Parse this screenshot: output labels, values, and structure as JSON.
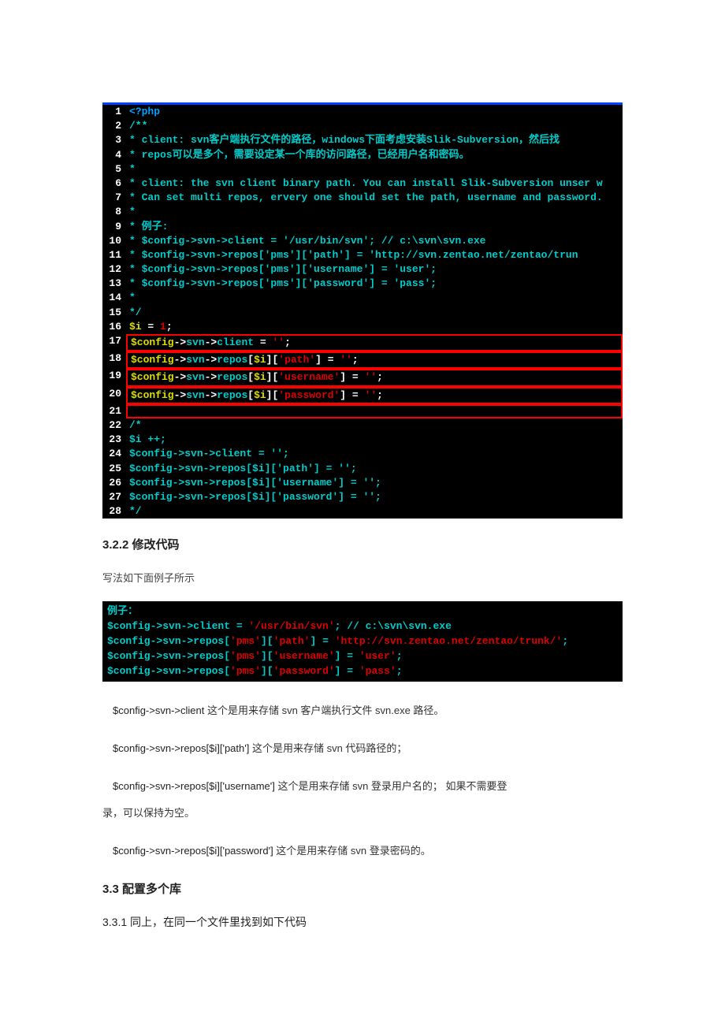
{
  "code1": {
    "lines": [
      {
        "n": 1,
        "segs": [
          {
            "t": "<?php",
            "c": "c-blue"
          }
        ]
      },
      {
        "n": 2,
        "segs": [
          {
            "t": "/**",
            "c": "c-cyan"
          }
        ]
      },
      {
        "n": 3,
        "segs": [
          {
            "t": " * client: svn客户端执行文件的路径，windows下面考虑安装Slik-Subversion，然后找",
            "c": "c-cyan"
          }
        ]
      },
      {
        "n": 4,
        "segs": [
          {
            "t": " * repos可以是多个，需要设定某一个库的访问路径，已经用户名和密码。",
            "c": "c-cyan"
          }
        ]
      },
      {
        "n": 5,
        "segs": [
          {
            "t": " *",
            "c": "c-cyan"
          }
        ]
      },
      {
        "n": 6,
        "segs": [
          {
            "t": " * client: the svn client binary path. You can install Slik-Subversion unser w",
            "c": "c-cyan"
          }
        ]
      },
      {
        "n": 7,
        "segs": [
          {
            "t": " * Can set multi repos, ervery one should set the path, username and password.",
            "c": "c-cyan"
          }
        ]
      },
      {
        "n": 8,
        "segs": [
          {
            "t": " *",
            "c": "c-cyan"
          }
        ]
      },
      {
        "n": 9,
        "segs": [
          {
            "t": " * 例子:",
            "c": "c-cyan"
          }
        ]
      },
      {
        "n": 10,
        "segs": [
          {
            "t": " * $config->svn->client = '/usr/bin/svn'; // c:\\svn\\svn.exe",
            "c": "c-cyan"
          }
        ]
      },
      {
        "n": 11,
        "segs": [
          {
            "t": " * $config->svn->repos['pms']['path']     = 'http://svn.zentao.net/zentao/trun",
            "c": "c-cyan"
          }
        ]
      },
      {
        "n": 12,
        "segs": [
          {
            "t": " * $config->svn->repos['pms']['username'] = 'user';",
            "c": "c-cyan"
          }
        ]
      },
      {
        "n": 13,
        "segs": [
          {
            "t": " * $config->svn->repos['pms']['password'] = 'pass';",
            "c": "c-cyan"
          }
        ]
      },
      {
        "n": 14,
        "segs": [
          {
            "t": " *",
            "c": "c-cyan"
          }
        ]
      },
      {
        "n": 15,
        "segs": [
          {
            "t": " */",
            "c": "c-cyan"
          }
        ]
      },
      {
        "n": 16,
        "segs": [
          {
            "t": "$i",
            "c": "c-yellow"
          },
          {
            "t": " = ",
            "c": "c-white"
          },
          {
            "t": "1",
            "c": "c-red"
          },
          {
            "t": ";",
            "c": "c-white"
          }
        ]
      },
      {
        "n": 17,
        "box": true,
        "segs": [
          {
            "t": "$config",
            "c": "c-yellow"
          },
          {
            "t": "->",
            "c": "c-white"
          },
          {
            "t": "svn",
            "c": "c-cyan"
          },
          {
            "t": "->",
            "c": "c-white"
          },
          {
            "t": "client",
            "c": "c-cyan"
          },
          {
            "t": " = ",
            "c": "c-white"
          },
          {
            "t": "''",
            "c": "c-red"
          },
          {
            "t": ";",
            "c": "c-white"
          }
        ]
      },
      {
        "n": 18,
        "box": true,
        "segs": [
          {
            "t": "$config",
            "c": "c-yellow"
          },
          {
            "t": "->",
            "c": "c-white"
          },
          {
            "t": "svn",
            "c": "c-cyan"
          },
          {
            "t": "->",
            "c": "c-white"
          },
          {
            "t": "repos",
            "c": "c-cyan"
          },
          {
            "t": "[",
            "c": "c-white"
          },
          {
            "t": "$i",
            "c": "c-yellow"
          },
          {
            "t": "][",
            "c": "c-white"
          },
          {
            "t": "'path'",
            "c": "c-red"
          },
          {
            "t": "]     = ",
            "c": "c-white"
          },
          {
            "t": "''",
            "c": "c-red"
          },
          {
            "t": ";",
            "c": "c-white"
          }
        ]
      },
      {
        "n": 19,
        "box": true,
        "segs": [
          {
            "t": "$config",
            "c": "c-yellow"
          },
          {
            "t": "->",
            "c": "c-white"
          },
          {
            "t": "svn",
            "c": "c-cyan"
          },
          {
            "t": "->",
            "c": "c-white"
          },
          {
            "t": "repos",
            "c": "c-cyan"
          },
          {
            "t": "[",
            "c": "c-white"
          },
          {
            "t": "$i",
            "c": "c-yellow"
          },
          {
            "t": "][",
            "c": "c-white"
          },
          {
            "t": "'username'",
            "c": "c-red"
          },
          {
            "t": "] = ",
            "c": "c-white"
          },
          {
            "t": "''",
            "c": "c-red"
          },
          {
            "t": ";",
            "c": "c-white"
          }
        ]
      },
      {
        "n": 20,
        "box": true,
        "segs": [
          {
            "t": "$config",
            "c": "c-yellow"
          },
          {
            "t": "->",
            "c": "c-white"
          },
          {
            "t": "svn",
            "c": "c-cyan"
          },
          {
            "t": "->",
            "c": "c-white"
          },
          {
            "t": "repos",
            "c": "c-cyan"
          },
          {
            "t": "[",
            "c": "c-white"
          },
          {
            "t": "$i",
            "c": "c-yellow"
          },
          {
            "t": "][",
            "c": "c-white"
          },
          {
            "t": "'password'",
            "c": "c-red"
          },
          {
            "t": "] = ",
            "c": "c-white"
          },
          {
            "t": "''",
            "c": "c-red"
          },
          {
            "t": ";",
            "c": "c-white"
          }
        ]
      },
      {
        "n": 21,
        "box": true,
        "segs": [
          {
            "t": " ",
            "c": "c-white"
          }
        ]
      },
      {
        "n": 22,
        "segs": [
          {
            "t": "/*",
            "c": "c-cyan"
          }
        ]
      },
      {
        "n": 23,
        "segs": [
          {
            "t": "$i ++;",
            "c": "c-cyan"
          }
        ]
      },
      {
        "n": 24,
        "segs": [
          {
            "t": "$config->svn->client = '';",
            "c": "c-cyan"
          }
        ]
      },
      {
        "n": 25,
        "segs": [
          {
            "t": "$config->svn->repos[$i]['path']     = '';",
            "c": "c-cyan"
          }
        ]
      },
      {
        "n": 26,
        "segs": [
          {
            "t": "$config->svn->repos[$i]['username'] = '';",
            "c": "c-cyan"
          }
        ]
      },
      {
        "n": 27,
        "segs": [
          {
            "t": "$config->svn->repos[$i]['password'] = '';",
            "c": "c-cyan"
          }
        ]
      },
      {
        "n": 28,
        "segs": [
          {
            "t": " */",
            "c": "c-cyan"
          }
        ]
      }
    ]
  },
  "sec322": "3.2.2  修改代码",
  "para1": "写法如下面例子所示",
  "code2": {
    "line1": "例子：",
    "line2a": "$config->svn->client = ",
    "line2b": "'/usr/bin/svn'",
    "line2c": "; ",
    "line2d": "// c:\\svn\\svn.exe",
    "line3a": "$config->svn->repos[",
    "line3b": "'pms'",
    "line3c": "][",
    "line3d": "'path'",
    "line3e": "]     = ",
    "line3f": "'http://svn.zentao.net/zentao/trunk/'",
    "line3g": ";",
    "line4a": "$config->svn->repos[",
    "line4b": "'pms'",
    "line4c": "][",
    "line4d": "'username'",
    "line4e": "] = ",
    "line4f": "'user'",
    "line4g": ";",
    "line5a": "$config->svn->repos[",
    "line5b": "'pms'",
    "line5c": "][",
    "line5d": "'password'",
    "line5e": "] = ",
    "line5f": "'pass'",
    "line5g": ";"
  },
  "explain1_code": "$config->svn->client",
  "explain1_text": "  这个是用来存储 svn 客户端执行文件 svn.exe 路径。",
  "explain2_code": "$config->svn->repos[$i]['path']",
  "explain2_text": "    这个是用来存储 svn 代码路径的；",
  "explain3_code": "$config->svn->repos[$i]['username']",
  "explain3_text": "  这个是用来存储 svn 登录用户名的；   如果不需要登",
  "explain3_cont": "录，可以保持为空。",
  "explain4_code": "$config->svn->repos[$i]['password']",
  "explain4_text": "  这个是用来存储 svn 登录密码的。",
  "sec33": "3.3  配置多个库",
  "sec331": "3.3.1  同上，在同一个文件里找到如下代码"
}
